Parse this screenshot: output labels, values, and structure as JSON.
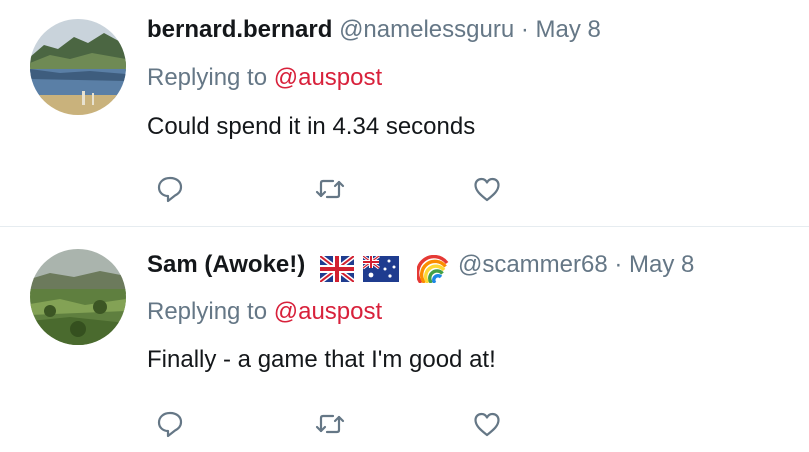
{
  "tweets": [
    {
      "display_name": "bernard.bernard",
      "handle": "@namelessguru",
      "separator": "·",
      "date": "May 8",
      "replying_prefix": "Replying to",
      "replying_to": "@auspost",
      "text": "Could spend it in 4.34 seconds",
      "avatar_icon": "lake-landscape-avatar"
    },
    {
      "display_name": "Sam (Awoke!)",
      "flags": [
        "uk-flag-icon",
        "australia-flag-icon",
        "rainbow-icon"
      ],
      "handle": "@scammer68",
      "separator": "·",
      "date": "May 8",
      "replying_prefix": "Replying to",
      "replying_to": "@auspost",
      "text": "Finally - a game that I'm good at!",
      "avatar_icon": "hills-landscape-avatar"
    }
  ],
  "actions": [
    "reply-icon",
    "retweet-icon",
    "like-icon"
  ],
  "colors": {
    "text": "#14171a",
    "secondary": "#657786",
    "mention": "#d8213b",
    "divider": "#e6ecf0"
  }
}
